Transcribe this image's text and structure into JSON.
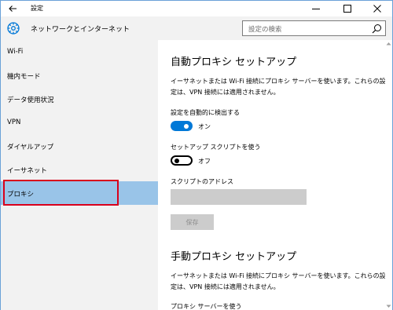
{
  "window": {
    "title": "設定",
    "controls": {
      "minimize": "minimize",
      "maximize": "maximize",
      "close": "close"
    }
  },
  "header": {
    "title": "ネットワークとインターネット",
    "icon": "globe-icon",
    "search_placeholder": "設定の検索"
  },
  "sidebar": {
    "items": [
      {
        "label": "Wi-Fi"
      },
      {
        "label": "機内モード"
      },
      {
        "label": "データ使用状況"
      },
      {
        "label": "VPN"
      },
      {
        "label": "ダイヤルアップ"
      },
      {
        "label": "イーサネット"
      },
      {
        "label": "プロキシ",
        "selected": true
      }
    ]
  },
  "content": {
    "auto_section": {
      "title": "自動プロキシ セットアップ",
      "description": "イーサネットまたは Wi-Fi 接続にプロキシ サーバーを使います。これらの設定は、VPN 接続には適用されません。",
      "auto_detect_label": "設定を自動的に検出する",
      "auto_detect_state": "オン",
      "setup_script_label": "セットアップ スクリプトを使う",
      "setup_script_state": "オフ",
      "script_address_label": "スクリプトのアドレス",
      "script_address_value": "",
      "save_label": "保存"
    },
    "manual_section": {
      "title": "手動プロキシ セットアップ",
      "description": "イーサネットまたは Wi-Fi 接続にプロキシ サーバーを使います。これらの設定は、VPN 接続には適用されません。",
      "use_proxy_label": "プロキシ サーバーを使う"
    }
  },
  "colors": {
    "accent": "#0078d7",
    "selected_bg": "#99c4e8",
    "sidebar_bg": "#f2f2f2",
    "highlight_border": "#d9001b"
  }
}
